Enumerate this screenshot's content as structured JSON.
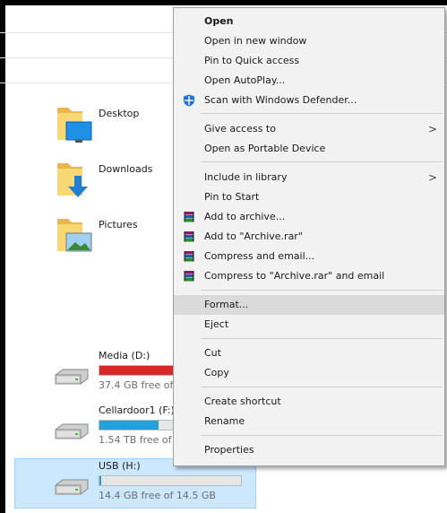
{
  "folders": [
    {
      "label": "Desktop"
    },
    {
      "label": "Downloads"
    },
    {
      "label": "Pictures"
    }
  ],
  "drives": [
    {
      "name": "Media (D:)",
      "free_text": "37.4 GB free of",
      "fill_fraction": 0.95,
      "bar_color": "#da2626"
    },
    {
      "name": "Cellardoor1 (F:)",
      "free_text": "1.54 TB free of",
      "fill_fraction": 0.42,
      "bar_color": "#26a0da"
    },
    {
      "name": "USB (H:)",
      "free_text": "14.4 GB free of 14.5 GB",
      "fill_fraction": 0.01,
      "bar_color": "#26a0da"
    }
  ],
  "context_menu": {
    "items": [
      {
        "label": "Open",
        "bold": true
      },
      {
        "label": "Open in new window"
      },
      {
        "label": "Pin to Quick access"
      },
      {
        "label": "Open AutoPlay..."
      },
      {
        "label": "Scan with Windows Defender...",
        "icon": "windows-defender-icon"
      },
      {
        "label": "Give access to",
        "submenu": true
      },
      {
        "label": "Open as Portable Device"
      },
      {
        "label": "Include in library",
        "submenu": true
      },
      {
        "label": "Pin to Start"
      },
      {
        "label": "Add to archive...",
        "icon": "winrar-icon"
      },
      {
        "label": "Add to \"Archive.rar\"",
        "icon": "winrar-icon"
      },
      {
        "label": "Compress and email...",
        "icon": "winrar-icon"
      },
      {
        "label": "Compress to \"Archive.rar\" and email",
        "icon": "winrar-icon"
      },
      {
        "label": "Format...",
        "highlighted": true
      },
      {
        "label": "Eject"
      },
      {
        "label": "Cut"
      },
      {
        "label": "Copy"
      },
      {
        "label": "Create shortcut"
      },
      {
        "label": "Rename"
      },
      {
        "label": "Properties"
      }
    ],
    "submenu_arrow": ">"
  },
  "colors": {
    "selection_bg": "#cce8ff",
    "menu_bg": "#f2f2f2",
    "menu_hover": "#dadada",
    "folder_yellow": "#f8d775"
  }
}
